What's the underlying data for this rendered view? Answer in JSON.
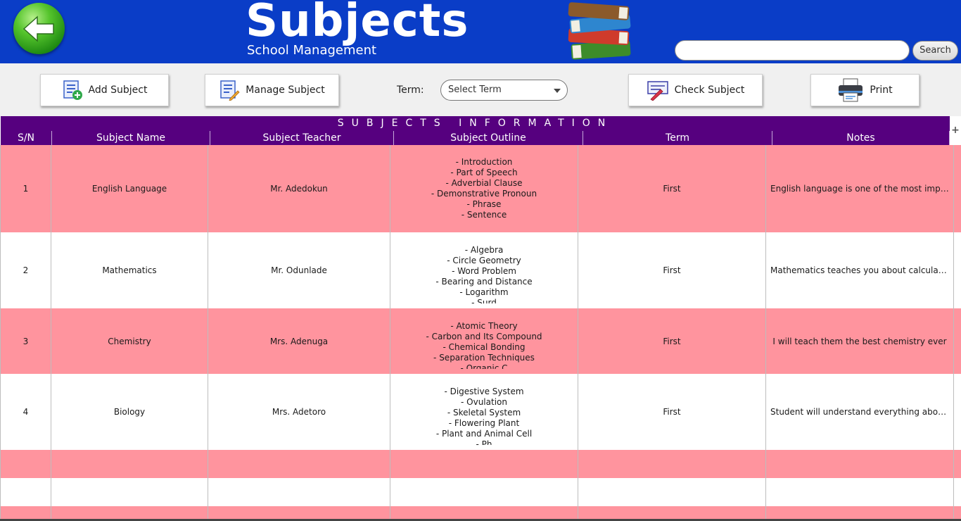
{
  "header": {
    "title": "Subjects",
    "subtitle": "School Management",
    "search_placeholder": "",
    "search_label": "Search",
    "colors": {
      "background": "#0a3dc7",
      "text": "#ffffff"
    },
    "icons": {
      "back": "back-arrow-icon",
      "logo": "books-stack-icon"
    }
  },
  "toolbar": {
    "add_label": "Add Subject",
    "manage_label": "Manage Subject",
    "term_label": "Term:",
    "term_value": "Select Term",
    "check_label": "Check Subject",
    "print_label": "Print",
    "icons": {
      "add": "add-list-icon",
      "manage": "edit-list-icon",
      "check": "checklist-pen-icon",
      "print": "printer-icon"
    }
  },
  "table": {
    "title": "SUBJECTS INFORMATION",
    "columns": [
      "S/N",
      "Subject Name",
      "Subject Teacher",
      "Subject Outline",
      "Term",
      "Notes"
    ],
    "colors": {
      "header": "#56007f",
      "row_alt": "#ff949e",
      "row": "#ffffff"
    },
    "rows": [
      {
        "sn": "1",
        "name": "English Language",
        "teacher": "Mr. Adedokun",
        "outline": [
          "- Introduction",
          "- Part of Speech",
          "- Adverbial Clause",
          "- Demonstrative Pronoun",
          "- Phrase",
          "- Sentence"
        ],
        "term": "First",
        "notes": "English language is one of the most important l..."
      },
      {
        "sn": "2",
        "name": "Mathematics",
        "teacher": "Mr. Odunlade",
        "outline": [
          "- Algebra",
          "- Circle Geometry",
          "- Word Problem",
          "- Bearing and Distance",
          "- Logarithm",
          "- Surd"
        ],
        "term": "First",
        "notes": "Mathematics teaches you about calculation"
      },
      {
        "sn": "3",
        "name": "Chemistry",
        "teacher": "Mrs. Adenuga",
        "outline": [
          "- Atomic Theory",
          "- Carbon and Its Compound",
          "- Chemical Bonding",
          "- Separation Techniques",
          "- Organic C"
        ],
        "term": "First",
        "notes": "I will teach them the best chemistry ever"
      },
      {
        "sn": "4",
        "name": "Biology",
        "teacher": "Mrs. Adetoro",
        "outline": [
          "- Digestive System",
          "- Ovulation",
          "- Skeletal System",
          "- Flowering Plant",
          "- Plant and Animal Cell",
          "- Ph"
        ],
        "term": "First",
        "notes": "Student will understand everything about Biolo..."
      }
    ]
  }
}
